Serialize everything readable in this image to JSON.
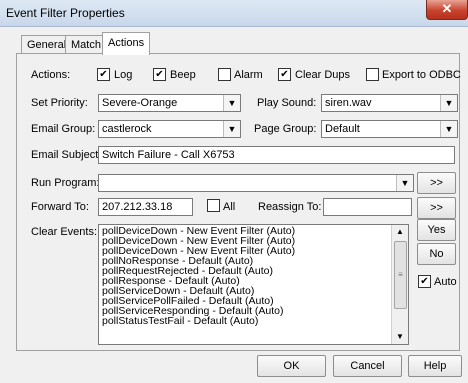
{
  "window": {
    "title": "Event Filter Properties",
    "close_glyph": "✕"
  },
  "tabs": [
    {
      "label": "General"
    },
    {
      "label": "Match"
    },
    {
      "label": "Actions"
    }
  ],
  "actions": {
    "label": "Actions:",
    "log": {
      "label": "Log",
      "checked": true
    },
    "beep": {
      "label": "Beep",
      "checked": true
    },
    "alarm": {
      "label": "Alarm",
      "checked": false
    },
    "clear_dups": {
      "label": "Clear Dups",
      "checked": true
    },
    "export_odbc": {
      "label": "Export to ODBC",
      "checked": false
    }
  },
  "set_priority": {
    "label": "Set Priority:",
    "value": "Severe-Orange"
  },
  "play_sound": {
    "label": "Play Sound:",
    "value": "siren.wav"
  },
  "email_group": {
    "label": "Email Group:",
    "value": "castlerock"
  },
  "page_group": {
    "label": "Page Group:",
    "value": "Default"
  },
  "email_subject": {
    "label": "Email Subject:",
    "value": "Switch Failure - Call X6753"
  },
  "run_program": {
    "label": "Run Program:",
    "value": "",
    "button": ">>"
  },
  "forward_to": {
    "label": "Forward To:",
    "value": "207.212.33.18",
    "all_label": "All",
    "all_checked": false
  },
  "reassign_to": {
    "label": "Reassign To:",
    "value": "",
    "button": ">>"
  },
  "clear_events": {
    "label": "Clear Events:",
    "items": [
      "pollDeviceDown - New Event Filter  (Auto)",
      "pollDeviceDown - New Event Filter  (Auto)",
      "pollDeviceDown - New Event Filter  (Auto)",
      "pollNoResponse -  Default  (Auto)",
      "pollRequestRejected -  Default  (Auto)",
      "pollResponse -  Default  (Auto)",
      "pollServiceDown -  Default  (Auto)",
      "pollServicePollFailed -  Default  (Auto)",
      "pollServiceResponding -  Default  (Auto)",
      "pollStatusTestFail -  Default  (Auto)"
    ],
    "yes_label": "Yes",
    "no_label": "No",
    "auto_label": "Auto",
    "auto_checked": true
  },
  "footer": {
    "ok": "OK",
    "cancel": "Cancel",
    "help": "Help"
  }
}
